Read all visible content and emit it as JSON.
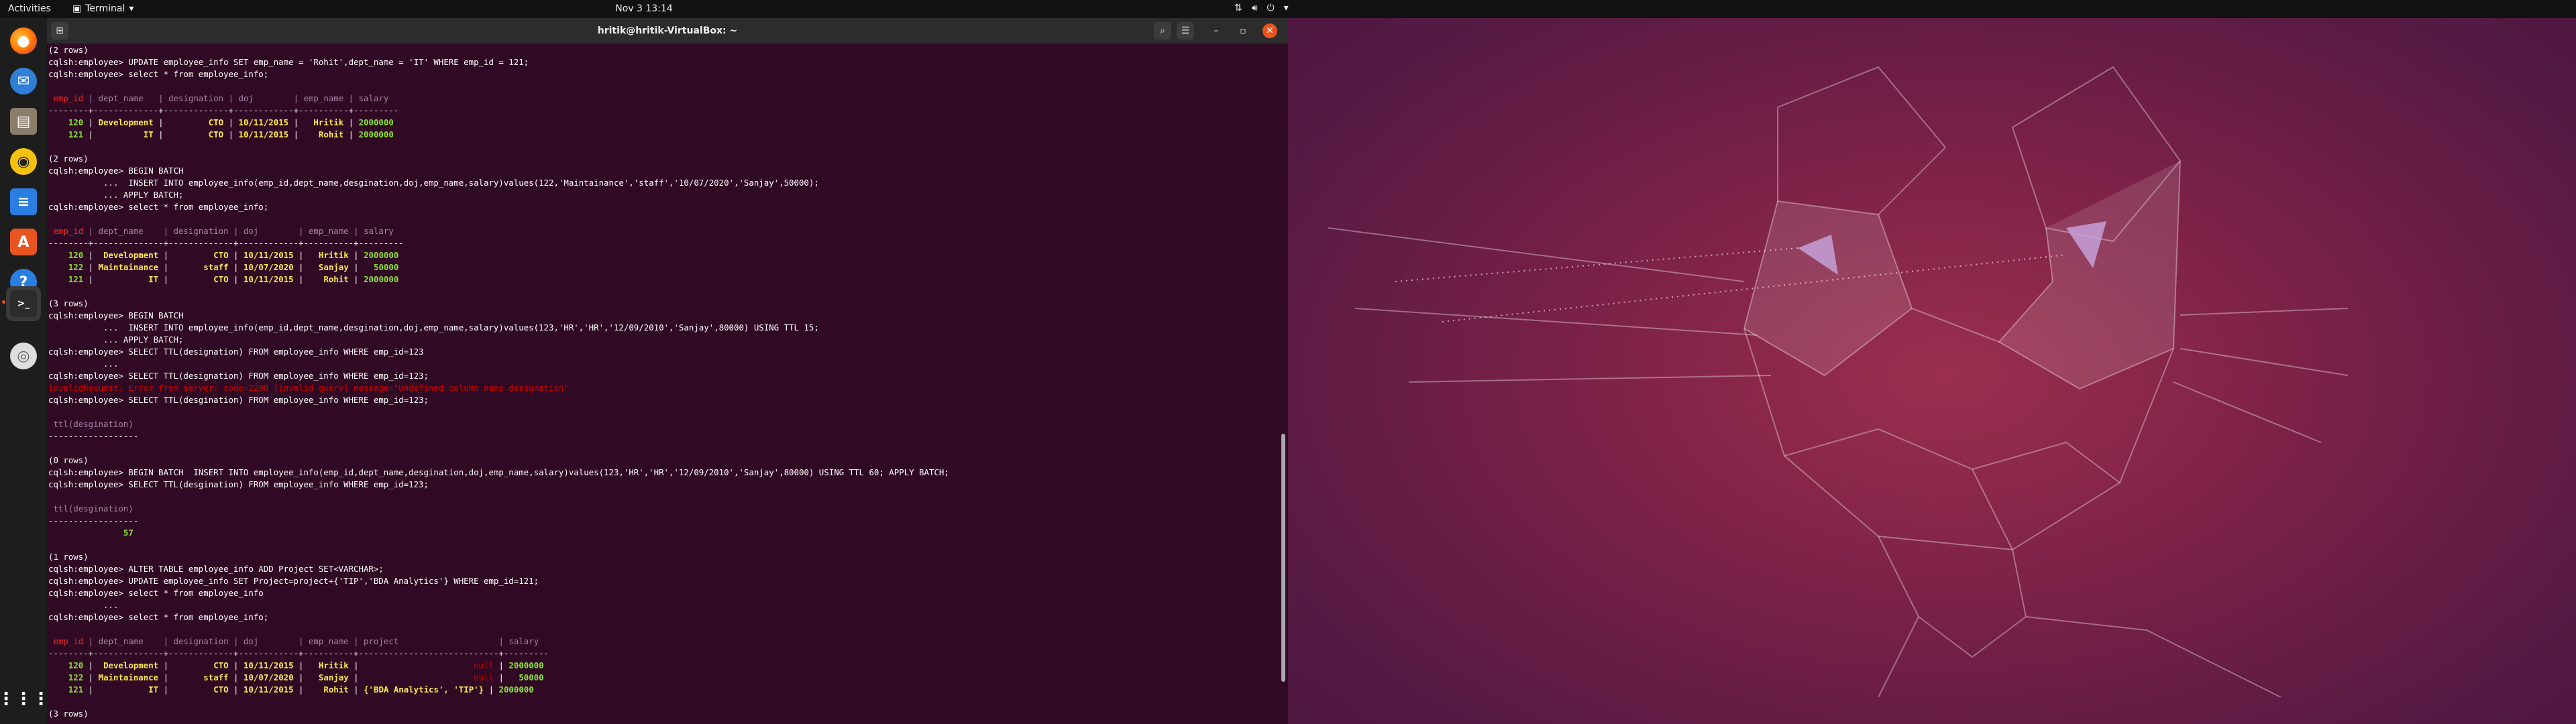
{
  "topbar": {
    "activities": "Activities",
    "app_name": "Terminal",
    "clock": "Nov 3  13:14"
  },
  "dock": {
    "items": [
      "firefox-icon",
      "thunderbird-icon",
      "files-icon",
      "rhythmbox-icon",
      "writer-icon",
      "software-icon",
      "help-icon",
      "terminal-icon",
      "disc-icon",
      "apps-grid-icon"
    ]
  },
  "window": {
    "title": "hritik@hritik-VirtualBox: ~"
  },
  "colors": {
    "terminal_bg": "#300a24",
    "header_red": "#ef2929",
    "header_magenta": "#ad7fa8",
    "value_yellow": "#fce94f",
    "value_green": "#8ae234",
    "error": "#cc0000",
    "accent": "#e95420"
  },
  "terminal": {
    "lines": [
      [
        {
          "t": "(2 rows)",
          "c": "white"
        }
      ],
      [
        {
          "t": "cqlsh:employee> UPDATE employee_info SET emp_name = 'Rohit',dept_name = 'IT' WHERE emp_id = 121;",
          "c": "white"
        }
      ],
      [
        {
          "t": "cqlsh:employee> select * from employee_info;",
          "c": "white"
        }
      ],
      [
        {
          "t": "",
          "c": "white"
        }
      ],
      [
        {
          "t": " emp_id",
          "c": "red"
        },
        {
          "t": " | ",
          "c": "magenta"
        },
        {
          "t": "dept_name",
          "c": "magenta"
        },
        {
          "t": "   | ",
          "c": "magenta"
        },
        {
          "t": "designation",
          "c": "magenta"
        },
        {
          "t": " | ",
          "c": "magenta"
        },
        {
          "t": "doj",
          "c": "magenta"
        },
        {
          "t": "        | ",
          "c": "magenta"
        },
        {
          "t": "emp_name",
          "c": "magenta"
        },
        {
          "t": " | ",
          "c": "magenta"
        },
        {
          "t": "salary",
          "c": "magenta"
        }
      ],
      [
        {
          "t": "--------+-------------+-------------+------------+----------+---------",
          "c": "white"
        }
      ],
      [
        {
          "t": "    120",
          "c": "green"
        },
        {
          "t": " | ",
          "c": "white"
        },
        {
          "t": "Development",
          "c": "yellow"
        },
        {
          "t": " | ",
          "c": "white"
        },
        {
          "t": "        CTO",
          "c": "yellow"
        },
        {
          "t": " | ",
          "c": "white"
        },
        {
          "t": "10/11/2015",
          "c": "yellow"
        },
        {
          "t": " | ",
          "c": "white"
        },
        {
          "t": "  Hritik",
          "c": "yellow"
        },
        {
          "t": " | ",
          "c": "white"
        },
        {
          "t": "2000000",
          "c": "green"
        }
      ],
      [
        {
          "t": "    121",
          "c": "green"
        },
        {
          "t": " | ",
          "c": "white"
        },
        {
          "t": "         IT",
          "c": "yellow"
        },
        {
          "t": " | ",
          "c": "white"
        },
        {
          "t": "        CTO",
          "c": "yellow"
        },
        {
          "t": " | ",
          "c": "white"
        },
        {
          "t": "10/11/2015",
          "c": "yellow"
        },
        {
          "t": " | ",
          "c": "white"
        },
        {
          "t": "   Rohit",
          "c": "yellow"
        },
        {
          "t": " | ",
          "c": "white"
        },
        {
          "t": "2000000",
          "c": "green"
        }
      ],
      [
        {
          "t": "",
          "c": "white"
        }
      ],
      [
        {
          "t": "(2 rows)",
          "c": "white"
        }
      ],
      [
        {
          "t": "cqlsh:employee> BEGIN BATCH",
          "c": "white"
        }
      ],
      [
        {
          "t": "           ...  INSERT INTO employee_info(emp_id,dept_name,desgination,doj,emp_name,salary)values(122,'Maintainance','staff','10/07/2020','Sanjay',50000);",
          "c": "white"
        }
      ],
      [
        {
          "t": "           ... APPLY BATCH;",
          "c": "white"
        }
      ],
      [
        {
          "t": "cqlsh:employee> select * from employee_info;",
          "c": "white"
        }
      ],
      [
        {
          "t": "",
          "c": "white"
        }
      ],
      [
        {
          "t": " emp_id",
          "c": "red"
        },
        {
          "t": " | ",
          "c": "magenta"
        },
        {
          "t": "dept_name",
          "c": "magenta"
        },
        {
          "t": "    | ",
          "c": "magenta"
        },
        {
          "t": "designation",
          "c": "magenta"
        },
        {
          "t": " | ",
          "c": "magenta"
        },
        {
          "t": "doj",
          "c": "magenta"
        },
        {
          "t": "        | ",
          "c": "magenta"
        },
        {
          "t": "emp_name",
          "c": "magenta"
        },
        {
          "t": " | ",
          "c": "magenta"
        },
        {
          "t": "salary",
          "c": "magenta"
        }
      ],
      [
        {
          "t": "--------+--------------+-------------+------------+----------+---------",
          "c": "white"
        }
      ],
      [
        {
          "t": "    120",
          "c": "green"
        },
        {
          "t": " | ",
          "c": "white"
        },
        {
          "t": " Development",
          "c": "yellow"
        },
        {
          "t": " | ",
          "c": "white"
        },
        {
          "t": "        CTO",
          "c": "yellow"
        },
        {
          "t": " | ",
          "c": "white"
        },
        {
          "t": "10/11/2015",
          "c": "yellow"
        },
        {
          "t": " | ",
          "c": "white"
        },
        {
          "t": "  Hritik",
          "c": "yellow"
        },
        {
          "t": " | ",
          "c": "white"
        },
        {
          "t": "2000000",
          "c": "green"
        }
      ],
      [
        {
          "t": "    122",
          "c": "green"
        },
        {
          "t": " | ",
          "c": "white"
        },
        {
          "t": "Maintainance",
          "c": "yellow"
        },
        {
          "t": " | ",
          "c": "white"
        },
        {
          "t": "      staff",
          "c": "yellow"
        },
        {
          "t": " | ",
          "c": "white"
        },
        {
          "t": "10/07/2020",
          "c": "yellow"
        },
        {
          "t": " | ",
          "c": "white"
        },
        {
          "t": "  Sanjay",
          "c": "yellow"
        },
        {
          "t": " | ",
          "c": "white"
        },
        {
          "t": "  50000",
          "c": "green"
        }
      ],
      [
        {
          "t": "    121",
          "c": "green"
        },
        {
          "t": " | ",
          "c": "white"
        },
        {
          "t": "          IT",
          "c": "yellow"
        },
        {
          "t": " | ",
          "c": "white"
        },
        {
          "t": "        CTO",
          "c": "yellow"
        },
        {
          "t": " | ",
          "c": "white"
        },
        {
          "t": "10/11/2015",
          "c": "yellow"
        },
        {
          "t": " | ",
          "c": "white"
        },
        {
          "t": "   Rohit",
          "c": "yellow"
        },
        {
          "t": " | ",
          "c": "white"
        },
        {
          "t": "2000000",
          "c": "green"
        }
      ],
      [
        {
          "t": "",
          "c": "white"
        }
      ],
      [
        {
          "t": "(3 rows)",
          "c": "white"
        }
      ],
      [
        {
          "t": "cqlsh:employee> BEGIN BATCH",
          "c": "white"
        }
      ],
      [
        {
          "t": "           ...  INSERT INTO employee_info(emp_id,dept_name,desgination,doj,emp_name,salary)values(123,'HR','HR','12/09/2010','Sanjay',80000) USING TTL 15;",
          "c": "white"
        }
      ],
      [
        {
          "t": "           ... APPLY BATCH;",
          "c": "white"
        }
      ],
      [
        {
          "t": "cqlsh:employee> SELECT TTL(designation) FROM employee_info WHERE emp_id=123",
          "c": "white"
        }
      ],
      [
        {
          "t": "           ...",
          "c": "white"
        }
      ],
      [
        {
          "t": "cqlsh:employee> SELECT TTL(designation) FROM employee_info WHERE emp_id=123;",
          "c": "white"
        }
      ],
      [
        {
          "t": "InvalidRequest: Error from server: code=2200 [Invalid query] message=\"Undefined column name designation\"",
          "c": "err"
        }
      ],
      [
        {
          "t": "cqlsh:employee> SELECT TTL(desgination) FROM employee_info WHERE emp_id=123;",
          "c": "white"
        }
      ],
      [
        {
          "t": "",
          "c": "white"
        }
      ],
      [
        {
          "t": " ttl(desgination)",
          "c": "magenta"
        }
      ],
      [
        {
          "t": "------------------",
          "c": "white"
        }
      ],
      [
        {
          "t": "",
          "c": "white"
        }
      ],
      [
        {
          "t": "(0 rows)",
          "c": "white"
        }
      ],
      [
        {
          "t": "cqlsh:employee> BEGIN BATCH  INSERT INTO employee_info(emp_id,dept_name,desgination,doj,emp_name,salary)values(123,'HR','HR','12/09/2010','Sanjay',80000) USING TTL 60; APPLY BATCH;",
          "c": "white"
        }
      ],
      [
        {
          "t": "cqlsh:employee> SELECT TTL(desgination) FROM employee_info WHERE emp_id=123;",
          "c": "white"
        }
      ],
      [
        {
          "t": "",
          "c": "white"
        }
      ],
      [
        {
          "t": " ttl(desgination)",
          "c": "magenta"
        }
      ],
      [
        {
          "t": "------------------",
          "c": "white"
        }
      ],
      [
        {
          "t": "               57",
          "c": "green"
        }
      ],
      [
        {
          "t": "",
          "c": "white"
        }
      ],
      [
        {
          "t": "(1 rows)",
          "c": "white"
        }
      ],
      [
        {
          "t": "cqlsh:employee> ALTER TABLE employee_info ADD Project SET<VARCHAR>;",
          "c": "white"
        }
      ],
      [
        {
          "t": "cqlsh:employee> UPDATE employee_info SET Project=project+{'TIP','BDA Analytics'} WHERE emp_id=121;",
          "c": "white"
        }
      ],
      [
        {
          "t": "cqlsh:employee> select * from employee_info",
          "c": "white"
        }
      ],
      [
        {
          "t": "           ...",
          "c": "white"
        }
      ],
      [
        {
          "t": "cqlsh:employee> select * from employee_info;",
          "c": "white"
        }
      ],
      [
        {
          "t": "",
          "c": "white"
        }
      ],
      [
        {
          "t": " emp_id",
          "c": "red"
        },
        {
          "t": " | ",
          "c": "magenta"
        },
        {
          "t": "dept_name",
          "c": "magenta"
        },
        {
          "t": "    | ",
          "c": "magenta"
        },
        {
          "t": "designation",
          "c": "magenta"
        },
        {
          "t": " | ",
          "c": "magenta"
        },
        {
          "t": "doj",
          "c": "magenta"
        },
        {
          "t": "        | ",
          "c": "magenta"
        },
        {
          "t": "emp_name",
          "c": "magenta"
        },
        {
          "t": " | ",
          "c": "magenta"
        },
        {
          "t": "project",
          "c": "magenta"
        },
        {
          "t": "                    | ",
          "c": "magenta"
        },
        {
          "t": "salary",
          "c": "magenta"
        }
      ],
      [
        {
          "t": "--------+--------------+-------------+------------+----------+----------------------------+---------",
          "c": "white"
        }
      ],
      [
        {
          "t": "    120",
          "c": "green"
        },
        {
          "t": " | ",
          "c": "white"
        },
        {
          "t": " Development",
          "c": "yellow"
        },
        {
          "t": " | ",
          "c": "white"
        },
        {
          "t": "        CTO",
          "c": "yellow"
        },
        {
          "t": " | ",
          "c": "white"
        },
        {
          "t": "10/11/2015",
          "c": "yellow"
        },
        {
          "t": " | ",
          "c": "white"
        },
        {
          "t": "  Hritik",
          "c": "yellow"
        },
        {
          "t": " | ",
          "c": "white"
        },
        {
          "t": "                      null",
          "c": "err"
        },
        {
          "t": " | ",
          "c": "white"
        },
        {
          "t": "2000000",
          "c": "green"
        }
      ],
      [
        {
          "t": "    122",
          "c": "green"
        },
        {
          "t": " | ",
          "c": "white"
        },
        {
          "t": "Maintainance",
          "c": "yellow"
        },
        {
          "t": " | ",
          "c": "white"
        },
        {
          "t": "      staff",
          "c": "yellow"
        },
        {
          "t": " | ",
          "c": "white"
        },
        {
          "t": "10/07/2020",
          "c": "yellow"
        },
        {
          "t": " | ",
          "c": "white"
        },
        {
          "t": "  Sanjay",
          "c": "yellow"
        },
        {
          "t": " | ",
          "c": "white"
        },
        {
          "t": "                      null",
          "c": "err"
        },
        {
          "t": " | ",
          "c": "white"
        },
        {
          "t": "  50000",
          "c": "green"
        }
      ],
      [
        {
          "t": "    121",
          "c": "green"
        },
        {
          "t": " | ",
          "c": "white"
        },
        {
          "t": "          IT",
          "c": "yellow"
        },
        {
          "t": " | ",
          "c": "white"
        },
        {
          "t": "        CTO",
          "c": "yellow"
        },
        {
          "t": " | ",
          "c": "white"
        },
        {
          "t": "10/11/2015",
          "c": "yellow"
        },
        {
          "t": " | ",
          "c": "white"
        },
        {
          "t": "   Rohit",
          "c": "yellow"
        },
        {
          "t": " | ",
          "c": "white"
        },
        {
          "t": "{'BDA Analytics', 'TIP'}",
          "c": "yellow"
        },
        {
          "t": " | ",
          "c": "white"
        },
        {
          "t": "2000000",
          "c": "green"
        }
      ],
      [
        {
          "t": "",
          "c": "white"
        }
      ],
      [
        {
          "t": "(3 rows)",
          "c": "white"
        }
      ]
    ]
  }
}
